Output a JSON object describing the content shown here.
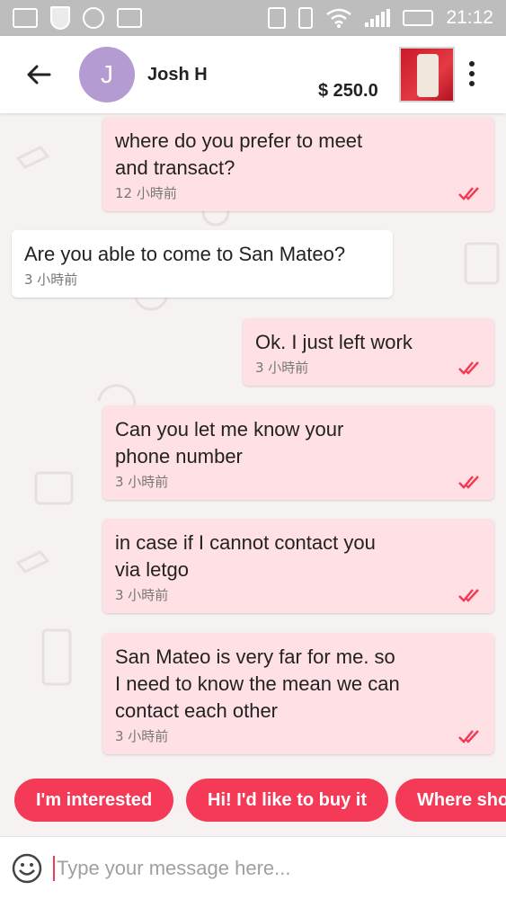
{
  "status_bar": {
    "time": "21:12",
    "icons": [
      "image-icon",
      "shield-icon",
      "headphones-icon",
      "keyboard-icon",
      "nfc-icon",
      "vibrate-icon",
      "wifi-icon",
      "signal-icon",
      "battery-icon"
    ]
  },
  "header": {
    "avatar_initial": "J",
    "contact_name": "Josh H",
    "price": "$ 250.0"
  },
  "messages": [
    {
      "direction": "out",
      "text": "where do you prefer to meet\nand transact?",
      "time": "12 小時前",
      "status": "read"
    },
    {
      "direction": "in",
      "text": "Are you able to come to San Mateo?",
      "time": "3 小時前"
    },
    {
      "direction": "out",
      "text": "Ok. I just left work",
      "time": "3 小時前",
      "status": "read"
    },
    {
      "direction": "out",
      "text": "Can you let me know your\nphone number",
      "time": "3 小時前",
      "status": "read"
    },
    {
      "direction": "out",
      "text": "in case if I cannot contact you\nvia letgo",
      "time": "3 小時前",
      "status": "read"
    },
    {
      "direction": "out",
      "text": "San Mateo is very far for me. so\nI need to know the mean we can\ncontact each other",
      "time": "3 小時前",
      "status": "read"
    }
  ],
  "quick_replies": [
    "I'm interested",
    "Hi! I'd like to buy it",
    "Where sho"
  ],
  "input": {
    "placeholder": "Type your message here..."
  },
  "colors": {
    "accent": "#f53a57",
    "outgoing_bubble": "#ffe1e5",
    "incoming_bubble": "#ffffff",
    "avatar": "#b49bd2",
    "read_ticks": "#f53a57"
  }
}
